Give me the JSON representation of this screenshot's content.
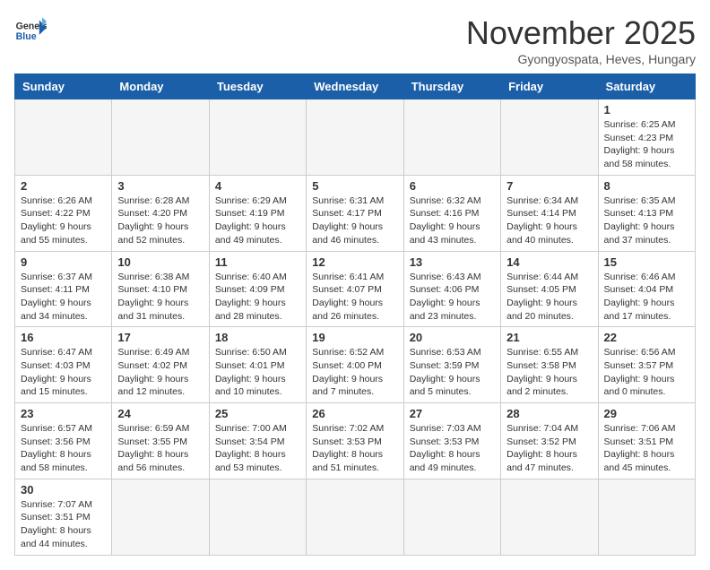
{
  "header": {
    "logo_general": "General",
    "logo_blue": "Blue",
    "title": "November 2025",
    "subtitle": "Gyongyospata, Heves, Hungary"
  },
  "days_of_week": [
    "Sunday",
    "Monday",
    "Tuesday",
    "Wednesday",
    "Thursday",
    "Friday",
    "Saturday"
  ],
  "weeks": [
    [
      {
        "day": "",
        "info": ""
      },
      {
        "day": "",
        "info": ""
      },
      {
        "day": "",
        "info": ""
      },
      {
        "day": "",
        "info": ""
      },
      {
        "day": "",
        "info": ""
      },
      {
        "day": "",
        "info": ""
      },
      {
        "day": "1",
        "info": "Sunrise: 6:25 AM\nSunset: 4:23 PM\nDaylight: 9 hours\nand 58 minutes."
      }
    ],
    [
      {
        "day": "2",
        "info": "Sunrise: 6:26 AM\nSunset: 4:22 PM\nDaylight: 9 hours\nand 55 minutes."
      },
      {
        "day": "3",
        "info": "Sunrise: 6:28 AM\nSunset: 4:20 PM\nDaylight: 9 hours\nand 52 minutes."
      },
      {
        "day": "4",
        "info": "Sunrise: 6:29 AM\nSunset: 4:19 PM\nDaylight: 9 hours\nand 49 minutes."
      },
      {
        "day": "5",
        "info": "Sunrise: 6:31 AM\nSunset: 4:17 PM\nDaylight: 9 hours\nand 46 minutes."
      },
      {
        "day": "6",
        "info": "Sunrise: 6:32 AM\nSunset: 4:16 PM\nDaylight: 9 hours\nand 43 minutes."
      },
      {
        "day": "7",
        "info": "Sunrise: 6:34 AM\nSunset: 4:14 PM\nDaylight: 9 hours\nand 40 minutes."
      },
      {
        "day": "8",
        "info": "Sunrise: 6:35 AM\nSunset: 4:13 PM\nDaylight: 9 hours\nand 37 minutes."
      }
    ],
    [
      {
        "day": "9",
        "info": "Sunrise: 6:37 AM\nSunset: 4:11 PM\nDaylight: 9 hours\nand 34 minutes."
      },
      {
        "day": "10",
        "info": "Sunrise: 6:38 AM\nSunset: 4:10 PM\nDaylight: 9 hours\nand 31 minutes."
      },
      {
        "day": "11",
        "info": "Sunrise: 6:40 AM\nSunset: 4:09 PM\nDaylight: 9 hours\nand 28 minutes."
      },
      {
        "day": "12",
        "info": "Sunrise: 6:41 AM\nSunset: 4:07 PM\nDaylight: 9 hours\nand 26 minutes."
      },
      {
        "day": "13",
        "info": "Sunrise: 6:43 AM\nSunset: 4:06 PM\nDaylight: 9 hours\nand 23 minutes."
      },
      {
        "day": "14",
        "info": "Sunrise: 6:44 AM\nSunset: 4:05 PM\nDaylight: 9 hours\nand 20 minutes."
      },
      {
        "day": "15",
        "info": "Sunrise: 6:46 AM\nSunset: 4:04 PM\nDaylight: 9 hours\nand 17 minutes."
      }
    ],
    [
      {
        "day": "16",
        "info": "Sunrise: 6:47 AM\nSunset: 4:03 PM\nDaylight: 9 hours\nand 15 minutes."
      },
      {
        "day": "17",
        "info": "Sunrise: 6:49 AM\nSunset: 4:02 PM\nDaylight: 9 hours\nand 12 minutes."
      },
      {
        "day": "18",
        "info": "Sunrise: 6:50 AM\nSunset: 4:01 PM\nDaylight: 9 hours\nand 10 minutes."
      },
      {
        "day": "19",
        "info": "Sunrise: 6:52 AM\nSunset: 4:00 PM\nDaylight: 9 hours\nand 7 minutes."
      },
      {
        "day": "20",
        "info": "Sunrise: 6:53 AM\nSunset: 3:59 PM\nDaylight: 9 hours\nand 5 minutes."
      },
      {
        "day": "21",
        "info": "Sunrise: 6:55 AM\nSunset: 3:58 PM\nDaylight: 9 hours\nand 2 minutes."
      },
      {
        "day": "22",
        "info": "Sunrise: 6:56 AM\nSunset: 3:57 PM\nDaylight: 9 hours\nand 0 minutes."
      }
    ],
    [
      {
        "day": "23",
        "info": "Sunrise: 6:57 AM\nSunset: 3:56 PM\nDaylight: 8 hours\nand 58 minutes."
      },
      {
        "day": "24",
        "info": "Sunrise: 6:59 AM\nSunset: 3:55 PM\nDaylight: 8 hours\nand 56 minutes."
      },
      {
        "day": "25",
        "info": "Sunrise: 7:00 AM\nSunset: 3:54 PM\nDaylight: 8 hours\nand 53 minutes."
      },
      {
        "day": "26",
        "info": "Sunrise: 7:02 AM\nSunset: 3:53 PM\nDaylight: 8 hours\nand 51 minutes."
      },
      {
        "day": "27",
        "info": "Sunrise: 7:03 AM\nSunset: 3:53 PM\nDaylight: 8 hours\nand 49 minutes."
      },
      {
        "day": "28",
        "info": "Sunrise: 7:04 AM\nSunset: 3:52 PM\nDaylight: 8 hours\nand 47 minutes."
      },
      {
        "day": "29",
        "info": "Sunrise: 7:06 AM\nSunset: 3:51 PM\nDaylight: 8 hours\nand 45 minutes."
      }
    ],
    [
      {
        "day": "30",
        "info": "Sunrise: 7:07 AM\nSunset: 3:51 PM\nDaylight: 8 hours\nand 44 minutes."
      },
      {
        "day": "",
        "info": ""
      },
      {
        "day": "",
        "info": ""
      },
      {
        "day": "",
        "info": ""
      },
      {
        "day": "",
        "info": ""
      },
      {
        "day": "",
        "info": ""
      },
      {
        "day": "",
        "info": ""
      }
    ]
  ]
}
